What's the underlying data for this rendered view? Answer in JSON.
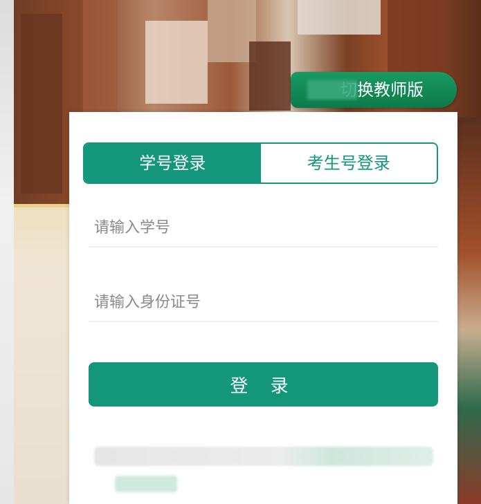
{
  "header": {
    "teacher_switch_label": "切换教师版"
  },
  "login": {
    "tabs": [
      {
        "label": "学号登录",
        "active": true
      },
      {
        "label": "考生号登录",
        "active": false
      }
    ],
    "student_id": {
      "placeholder": "请输入学号",
      "value": ""
    },
    "id_card": {
      "placeholder": "请输入身份证号",
      "value": ""
    },
    "submit_label": "登 录"
  },
  "colors": {
    "primary": "#13967a",
    "switch_green": "#0f8a55",
    "card_bg": "#ffffff"
  }
}
